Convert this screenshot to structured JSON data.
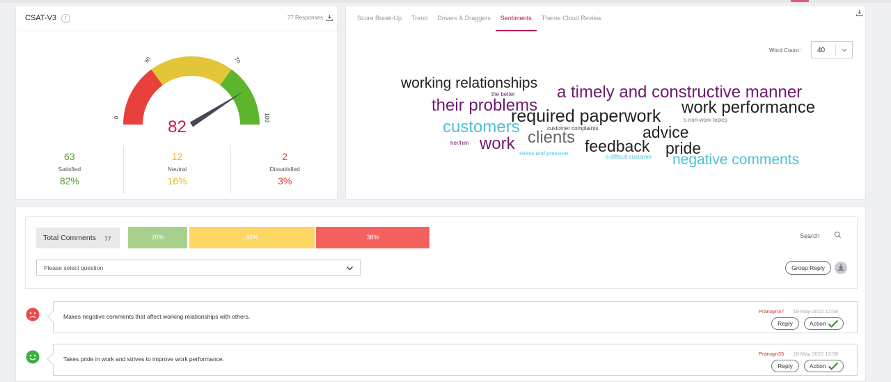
{
  "csat": {
    "title": "CSAT-V3",
    "responses": "77 Responses",
    "score": "82",
    "gauge_value": 82,
    "gauge_ticks": [
      "0",
      "30",
      "70",
      "100"
    ],
    "colors": {
      "dissatisfied": "#e8403b",
      "neutral": "#e2c637",
      "satisfied": "#5cb52d",
      "score": "#c2185b"
    },
    "stats": [
      {
        "count": "63",
        "label": "Satisfied",
        "pct": "82%",
        "color": "#5a9a32"
      },
      {
        "count": "12",
        "label": "Neutral",
        "pct": "16%",
        "color": "#e0b93a"
      },
      {
        "count": "2",
        "label": "Dissatisfied",
        "pct": "3%",
        "color": "#d8413a"
      }
    ]
  },
  "tabs": [
    "Score Break-Up",
    "Trend",
    "Drivers & Draggers",
    "Sentiments",
    "Theme Cloud Review"
  ],
  "active_tab": "Sentiments",
  "word_count": {
    "label": "Word Count :",
    "value": "40"
  },
  "cloud": [
    {
      "text": "working relationships",
      "color": "#222222"
    },
    {
      "text": "the better",
      "color": "#6d1a6d"
    },
    {
      "text": "a timely and constructive manner",
      "color": "#6d1a6d"
    },
    {
      "text": "their problems",
      "color": "#6d1a6d"
    },
    {
      "text": "required paperwork",
      "color": "#222222"
    },
    {
      "text": "work performance",
      "color": "#222222"
    },
    {
      "text": "customers",
      "color": "#4ec0d8"
    },
    {
      "text": "'s non-work topics",
      "color": "#777777"
    },
    {
      "text": "customer complaints",
      "color": "#444444"
    },
    {
      "text": "advice",
      "color": "#222222"
    },
    {
      "text": "clients",
      "color": "#666666"
    },
    {
      "text": "her/him",
      "color": "#6d1a6d"
    },
    {
      "text": "work",
      "color": "#6d1a6d"
    },
    {
      "text": "feedback",
      "color": "#222222"
    },
    {
      "text": "pride",
      "color": "#222222"
    },
    {
      "text": "stress and pressure",
      "color": "#4ec0d8"
    },
    {
      "text": "a difficult customer",
      "color": "#4ec0d8"
    },
    {
      "text": "negative comments",
      "color": "#4ec0d8"
    }
  ],
  "comments_panel": {
    "total_label": "Total Comments",
    "total_count": "77",
    "bars": [
      {
        "label": "20%",
        "value": 20,
        "color": "#a8d08d"
      },
      {
        "label": "42%",
        "value": 42,
        "color": "#fdd663"
      },
      {
        "label": "38%",
        "value": 38,
        "color": "#f4615f"
      }
    ],
    "search_label": "Search",
    "question_placeholder": "Please select question",
    "group_reply": "Group Reply"
  },
  "comments": [
    {
      "text": "Makes negative comments that affect working relationships with others.",
      "user": "Pranayn37",
      "date": "18-May-2022 12:58",
      "sentiment": "negative",
      "reply": "Reply",
      "action": "Action"
    },
    {
      "text": "Takes pride in work and strives to improve work performance.",
      "user": "Pranayn35",
      "date": "18-May-2022 12:58",
      "sentiment": "positive",
      "reply": "Reply",
      "action": "Action"
    }
  ]
}
